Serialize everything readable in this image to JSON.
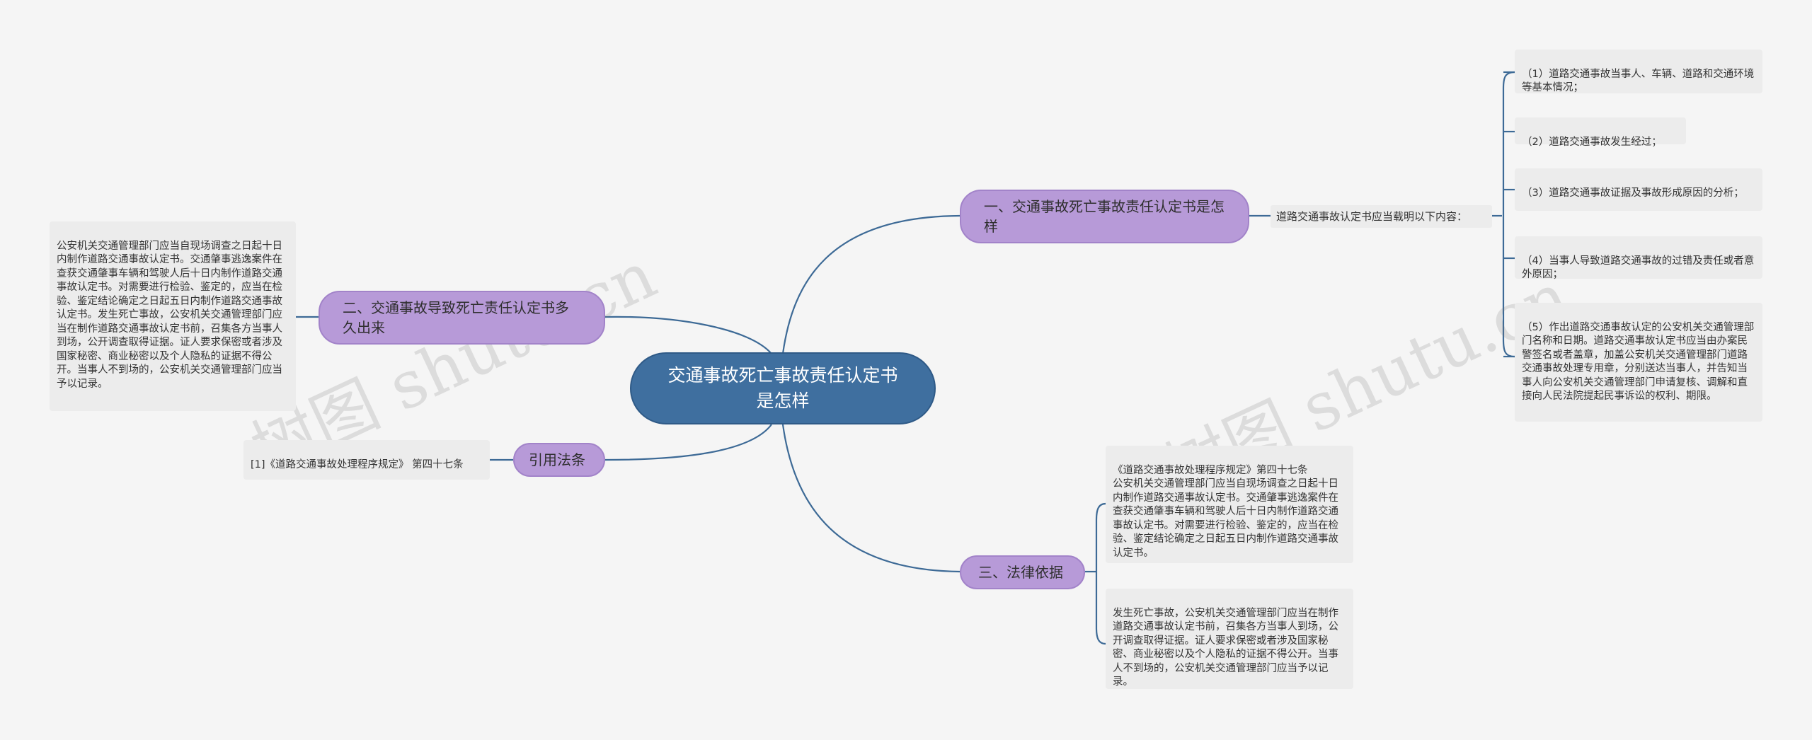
{
  "root": {
    "title": "交通事故死亡事故责任认定书是怎样"
  },
  "branches": {
    "b1": {
      "label": "一、交通事故死亡事故责任认定书是怎样"
    },
    "b2": {
      "label": "二、交通事故导致死亡责任认定书多久出来"
    },
    "b3": {
      "label": "引用法条"
    },
    "b4": {
      "label": "三、法律依据"
    }
  },
  "b1_mid": {
    "text": "道路交通事故认定书应当载明以下内容："
  },
  "b1_items": [
    "（1）道路交通事故当事人、车辆、道路和交通环境等基本情况；",
    "（2）道路交通事故发生经过；",
    "（3）道路交通事故证据及事故形成原因的分析；",
    "（4）当事人导致道路交通事故的过错及责任或者意外原因；",
    "（5）作出道路交通事故认定的公安机关交通管理部门名称和日期。道路交通事故认定书应当由办案民警签名或者盖章，加盖公安机关交通管理部门道路交通事故处理专用章，分别送达当事人，并告知当事人向公安机关交通管理部门申请复核、调解和直接向人民法院提起民事诉讼的权利、期限。"
  ],
  "b2_note": "公安机关交通管理部门应当自现场调查之日起十日内制作道路交通事故认定书。交通肇事逃逸案件在查获交通肇事车辆和驾驶人后十日内制作道路交通事故认定书。对需要进行检验、鉴定的，应当在检验、鉴定结论确定之日起五日内制作道路交通事故认定书。发生死亡事故，公安机关交通管理部门应当在制作道路交通事故认定书前，召集各方当事人到场，公开调查取得证据。证人要求保密或者涉及国家秘密、商业秘密以及个人隐私的证据不得公开。当事人不到场的，公安机关交通管理部门应当予以记录。",
  "b3_note": "[1]《道路交通事故处理程序规定》 第四十七条",
  "b4_items": [
    "《道路交通事故处理程序规定》第四十七条\n公安机关交通管理部门应当自现场调查之日起十日内制作道路交通事故认定书。交通肇事逃逸案件在查获交通肇事车辆和驾驶人后十日内制作道路交通事故认定书。对需要进行检验、鉴定的，应当在检验、鉴定结论确定之日起五日内制作道路交通事故认定书。",
    "发生死亡事故，公安机关交通管理部门应当在制作道路交通事故认定书前，召集各方当事人到场，公开调查取得证据。证人要求保密或者涉及国家秘密、商业秘密以及个人隐私的证据不得公开。当事人不到场的，公安机关交通管理部门应当予以记录。"
  ],
  "watermarks": [
    "树图 shutu.cn",
    "树图 shutu.cn"
  ],
  "colors": {
    "root": "#3f6f9f",
    "branch": "#b79ad8",
    "line": "#3d6a96",
    "note_bg": "#ececec"
  }
}
